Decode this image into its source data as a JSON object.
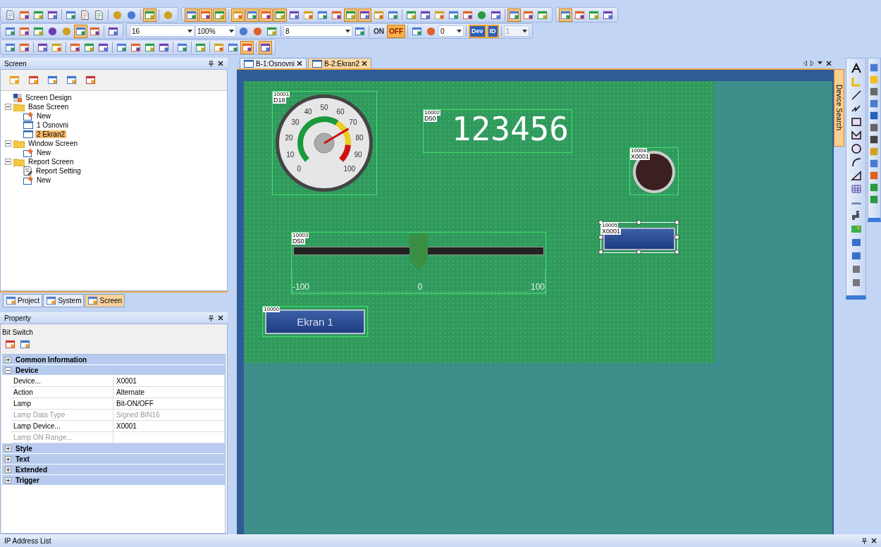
{
  "toolbar": {
    "font_size": "16",
    "zoom": "100%",
    "grid": "8",
    "toggles": [
      {
        "label": "ON",
        "selected": false
      },
      {
        "label": "OFF",
        "selected": true
      }
    ],
    "step": "0",
    "device_buttons": [
      {
        "label": "Dev",
        "selected": true
      },
      {
        "label": "ID",
        "selected": true
      }
    ],
    "layer": "1"
  },
  "screen_panel": {
    "title": "Screen",
    "tree": [
      {
        "label": "Screen Design",
        "kind": "design",
        "selected": false
      },
      {
        "label": "Base Screen",
        "kind": "folder",
        "expanded": true,
        "selected": false,
        "children": [
          {
            "label": "New",
            "kind": "new",
            "selected": false
          },
          {
            "label": "1 Osnovni",
            "kind": "screen",
            "selected": false
          },
          {
            "label": "2 Ekran2",
            "kind": "screen",
            "selected": true
          }
        ]
      },
      {
        "label": "Window Screen",
        "kind": "folder",
        "expanded": true,
        "selected": false,
        "children": [
          {
            "label": "New",
            "kind": "new",
            "selected": false
          }
        ]
      },
      {
        "label": "Report Screen",
        "kind": "folder",
        "expanded": true,
        "selected": false,
        "children": [
          {
            "label": "Report Setting",
            "kind": "report",
            "selected": false
          },
          {
            "label": "New",
            "kind": "new",
            "selected": false
          }
        ]
      }
    ]
  },
  "panel_tabs": [
    {
      "label": "Project",
      "selected": false
    },
    {
      "label": "System",
      "selected": false
    },
    {
      "label": "Screen",
      "selected": true
    }
  ],
  "property": {
    "title": "Property",
    "object_type": "Bit Switch",
    "groups": [
      {
        "name": "Common Information",
        "expanded": false
      },
      {
        "name": "Device",
        "expanded": true,
        "rows": [
          {
            "name": "Device...",
            "value": "X0001",
            "disabled": false
          },
          {
            "name": "Action",
            "value": "Alternate",
            "disabled": false
          },
          {
            "name": "Lamp",
            "value": "Bit-ON/OFF",
            "disabled": false
          },
          {
            "name": "Lamp Data Type",
            "value": "Signed BIN16",
            "disabled": true
          },
          {
            "name": "Lamp Device...",
            "value": "X0001",
            "disabled": false
          },
          {
            "name": "Lamp ON Range...",
            "disabled": true
          }
        ]
      },
      {
        "name": "Style",
        "expanded": false
      },
      {
        "name": "Text",
        "expanded": false
      },
      {
        "name": "Extended",
        "expanded": false
      },
      {
        "name": "Trigger",
        "expanded": false
      }
    ]
  },
  "editor_tabs": [
    {
      "label": "B-1:Osnovni",
      "selected": false
    },
    {
      "label": "B-2:Ekran2",
      "selected": true
    }
  ],
  "objects": [
    {
      "kind": "gauge",
      "id": "10001",
      "device": "D18",
      "scale": [
        "0",
        "10",
        "20",
        "30",
        "40",
        "50",
        "60",
        "70",
        "80",
        "90",
        "100"
      ],
      "level": 0.72,
      "selected": false
    },
    {
      "kind": "numeric",
      "id": "10002",
      "device": "D50",
      "value": "123456",
      "selected": false
    },
    {
      "kind": "lamp",
      "id": "10004",
      "device": "X0001",
      "selected": false
    },
    {
      "kind": "switch",
      "id": "10005",
      "device": "X0001",
      "selected": true
    },
    {
      "kind": "slider",
      "id": "10003",
      "device": "D50",
      "level": 0.5,
      "scale": [
        "-100",
        "0",
        "100"
      ],
      "selected": false
    },
    {
      "kind": "button",
      "id": "10000",
      "label": "Ekran 1",
      "selected": false
    }
  ],
  "side_tab": "Device Search",
  "bottom_panel": {
    "title": "IP Address List"
  }
}
